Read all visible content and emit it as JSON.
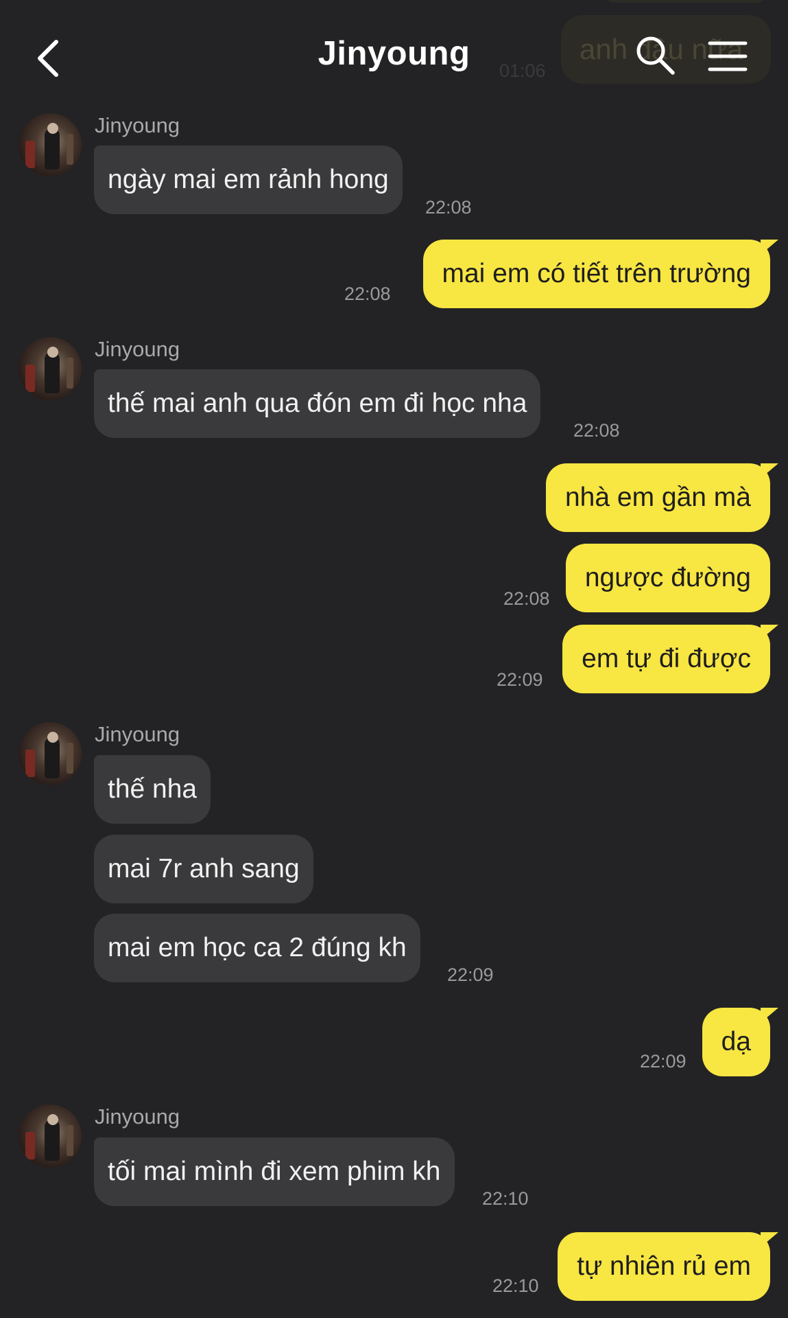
{
  "header": {
    "title": "Jinyoung",
    "background_preview_text": "anh đầu nữa",
    "background_preview_time": "01:06"
  },
  "contact": {
    "name": "Jinyoung"
  },
  "messages": [
    {
      "from": "contact",
      "text": "ngày mai em rảnh hong",
      "time": "22:08"
    },
    {
      "from": "me",
      "text": "mai em có tiết trên trường",
      "time": "22:08"
    },
    {
      "from": "contact",
      "text": "thế mai anh qua đón em đi học nha",
      "time": "22:08"
    },
    {
      "from": "me",
      "text": "nhà em gần mà",
      "time": ""
    },
    {
      "from": "me",
      "text": "ngược đường",
      "time": "22:08"
    },
    {
      "from": "me",
      "text": "em tự đi được",
      "time": "22:09"
    },
    {
      "from": "contact",
      "text": "thế nha",
      "time": ""
    },
    {
      "from": "contact",
      "text": "mai 7r anh sang",
      "time": ""
    },
    {
      "from": "contact",
      "text": "mai em học ca 2 đúng kh",
      "time": "22:09"
    },
    {
      "from": "me",
      "text": "dạ",
      "time": "22:09"
    },
    {
      "from": "contact",
      "text": "tối mai mình đi xem phim kh",
      "time": "22:10"
    },
    {
      "from": "me",
      "text": "tự nhiên rủ em",
      "time": "22:10"
    }
  ],
  "colors": {
    "background": "#232325",
    "incoming_bubble": "#3a3a3c",
    "outgoing_bubble": "#f8e642",
    "timestamp": "#9a9a9a"
  },
  "icons": {
    "back": "chevron-left-icon",
    "search": "search-icon",
    "menu": "hamburger-menu-icon"
  }
}
